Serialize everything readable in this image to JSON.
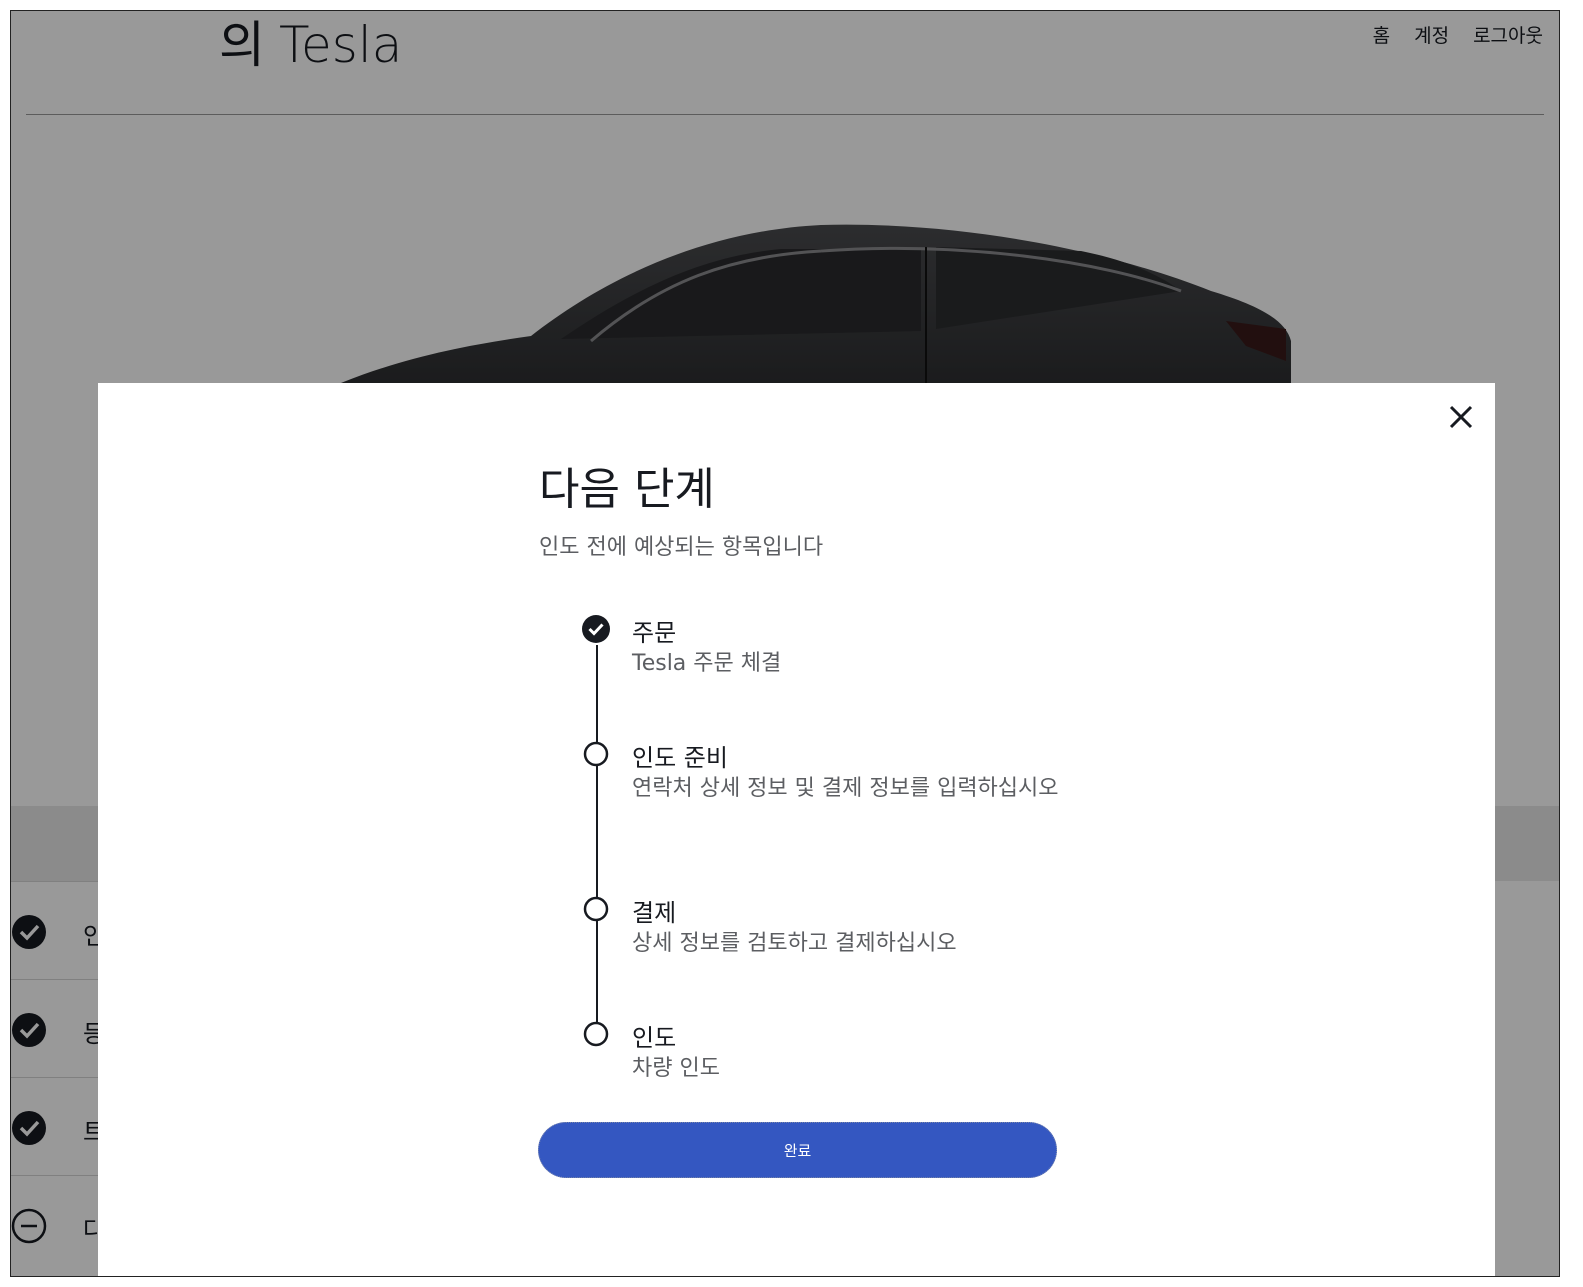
{
  "header": {
    "brand_prefix": "의",
    "brand_name": "Tesla",
    "nav": [
      "홈",
      "계정",
      "로그아웃"
    ]
  },
  "background_steps": [
    {
      "label": "인",
      "status": "done"
    },
    {
      "label": "등",
      "status": "done"
    },
    {
      "label": "트",
      "status": "done"
    },
    {
      "label": "다",
      "status": "pending"
    }
  ],
  "modal": {
    "title": "다음 단계",
    "subtitle": "인도 전에 예상되는 항목입니다",
    "steps": [
      {
        "title": "주문",
        "desc": "Tesla 주문 체결",
        "status": "complete"
      },
      {
        "title": "인도 준비",
        "desc": "연락처 상세 정보 및 결제 정보를 입력하십시오",
        "status": "incomplete"
      },
      {
        "title": "결제",
        "desc": "상세 정보를 검토하고 결제하십시오",
        "status": "incomplete"
      },
      {
        "title": "인도",
        "desc": "차량 인도",
        "status": "incomplete"
      }
    ],
    "button_label": "완료",
    "close_icon": "close-icon"
  },
  "colors": {
    "accent": "#3457c1",
    "text": "#171a20",
    "muted": "#5c5e62"
  }
}
